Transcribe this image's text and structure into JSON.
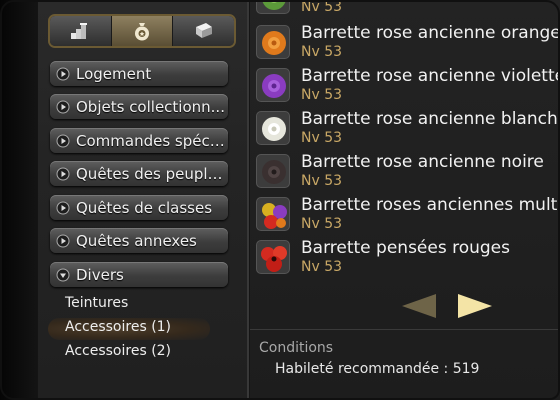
{
  "tabs": [
    {
      "icon": "chart-steps-icon",
      "active": false
    },
    {
      "icon": "money-bag-icon",
      "active": true
    },
    {
      "icon": "book-icon",
      "active": false
    }
  ],
  "categories": [
    {
      "label": "Logement",
      "expanded": false
    },
    {
      "label": "Objets collectionn...",
      "expanded": false
    },
    {
      "label": "Commandes spéci...",
      "expanded": false
    },
    {
      "label": "Quêtes des peuple...",
      "expanded": false
    },
    {
      "label": "Quêtes de classes",
      "expanded": false
    },
    {
      "label": "Quêtes annexes",
      "expanded": false
    },
    {
      "label": "Divers",
      "expanded": true
    }
  ],
  "subitems": [
    {
      "label": "Teintures",
      "selected": false
    },
    {
      "label": "Accessoires (1)",
      "selected": true
    },
    {
      "label": "Accessoires (2)",
      "selected": false
    }
  ],
  "items": [
    {
      "name": "",
      "level": "Nv 53",
      "color": "#5c9a3a"
    },
    {
      "name": "Barrette rose ancienne orange",
      "level": "Nv 53",
      "color": "#e07a1c"
    },
    {
      "name": "Barrette rose ancienne violette",
      "level": "Nv 53",
      "color": "#8a3cc0"
    },
    {
      "name": "Barrette rose ancienne blanche",
      "level": "Nv 53",
      "color": "#e6e6dc"
    },
    {
      "name": "Barrette rose ancienne noire",
      "level": "Nv 53",
      "color": "#3a3030"
    },
    {
      "name": "Barrette roses anciennes multi",
      "level": "Nv 53",
      "color": "#d8b020"
    },
    {
      "name": "Barrette pensées rouges",
      "level": "Nv 53",
      "color": "#d42a20"
    }
  ],
  "pager": {
    "prev_icon": "triangle-left-icon",
    "next_icon": "triangle-right-icon"
  },
  "conditions": {
    "title": "Conditions",
    "line": "Habileté recommandée : 519"
  },
  "colors": {
    "accent_gold": "#c9a866",
    "tab_border": "#6b5a33"
  }
}
